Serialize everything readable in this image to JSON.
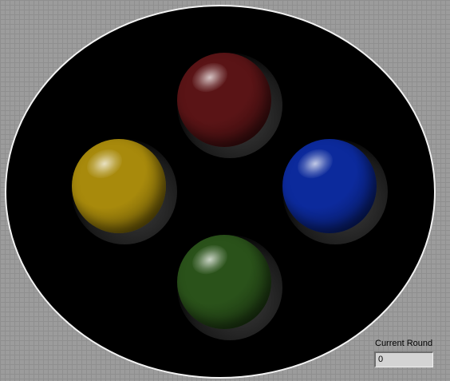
{
  "buttons": [
    {
      "id": "red",
      "label": "red",
      "color": "#5a1416"
    },
    {
      "id": "blue",
      "label": "blue",
      "color": "#0c2a9c"
    },
    {
      "id": "yellow",
      "label": "yellow",
      "color": "#a88a0c"
    },
    {
      "id": "green",
      "label": "green",
      "color": "#2a521a"
    }
  ],
  "board": {
    "background": "#000000",
    "border_color": "#f2f2f2"
  },
  "counter": {
    "label": "Current Round",
    "value": "0"
  }
}
